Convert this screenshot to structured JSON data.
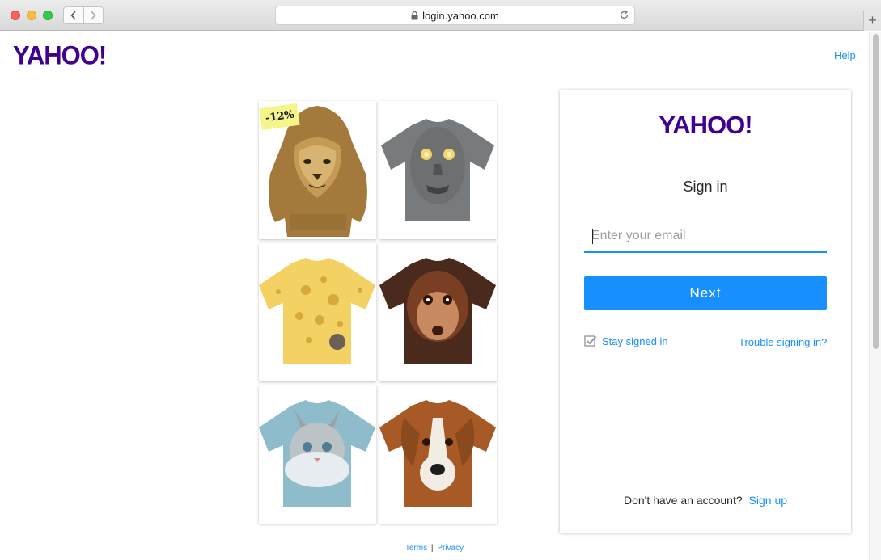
{
  "browser": {
    "url": "login.yahoo.com",
    "new_tab_symbol": "+"
  },
  "header": {
    "logo": "YAHOO!",
    "help": "Help"
  },
  "ad": {
    "discount_badge": "-12%",
    "tiles": [
      {
        "icon": "lion-hoodie-image"
      },
      {
        "icon": "zombie-tshirt-image"
      },
      {
        "icon": "cheese-tshirt-image"
      },
      {
        "icon": "orangutan-tshirt-image"
      },
      {
        "icon": "kitten-tshirt-image"
      },
      {
        "icon": "dog-tshirt-image"
      }
    ]
  },
  "footer": {
    "terms": "Terms",
    "separator": "|",
    "privacy": "Privacy"
  },
  "login": {
    "logo": "YAHOO!",
    "title": "Sign in",
    "email_placeholder": "Enter your email",
    "email_value": "",
    "next_label": "Next",
    "stay_signed_in": "Stay signed in",
    "trouble": "Trouble signing in?",
    "no_account": "Don't have an account?",
    "sign_up": "Sign up"
  },
  "colors": {
    "brand_purple": "#400090",
    "link_blue": "#188fff"
  }
}
